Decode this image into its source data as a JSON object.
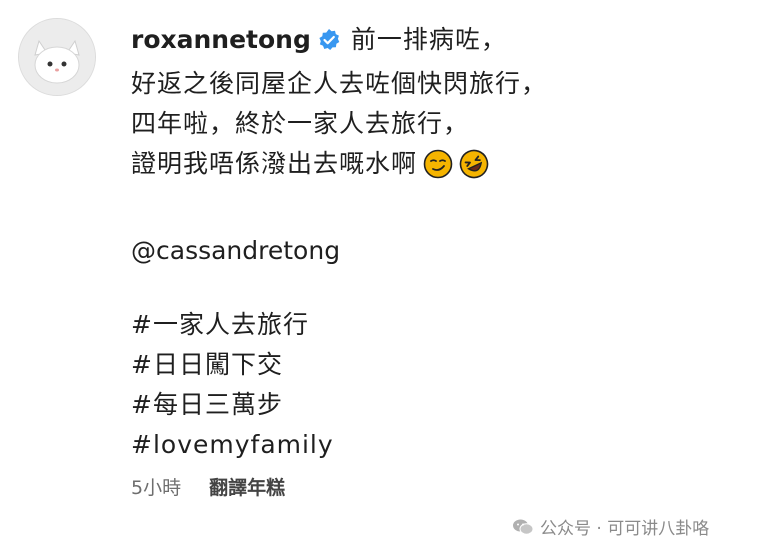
{
  "post": {
    "avatar_icon": "cat-avatar-icon",
    "username": "roxannetong",
    "verified_icon": "verified-badge-icon",
    "line1": "前一排病咗，",
    "line2": "好返之後同屋企人去咗個快閃旅行，",
    "line3": "四年啦，終於一家人去旅行，",
    "line4": "證明我唔係潑出去嘅水啊",
    "emoji1": "smirk-face-icon",
    "emoji2": "rolling-on-floor-laughing-icon",
    "mention": "@cassandretong",
    "hashtags": [
      "#一家人去旅行",
      "#日日闖下交",
      "#每日三萬步",
      "#lovemyfamily"
    ]
  },
  "footer": {
    "time": "5小時",
    "translate": "翻譯年糕"
  },
  "watermark": {
    "icon": "wechat-icon",
    "text": "公众号 · 可可讲八卦咯"
  },
  "colors": {
    "verified": "#3897f0",
    "emoji": "#f5b400"
  }
}
